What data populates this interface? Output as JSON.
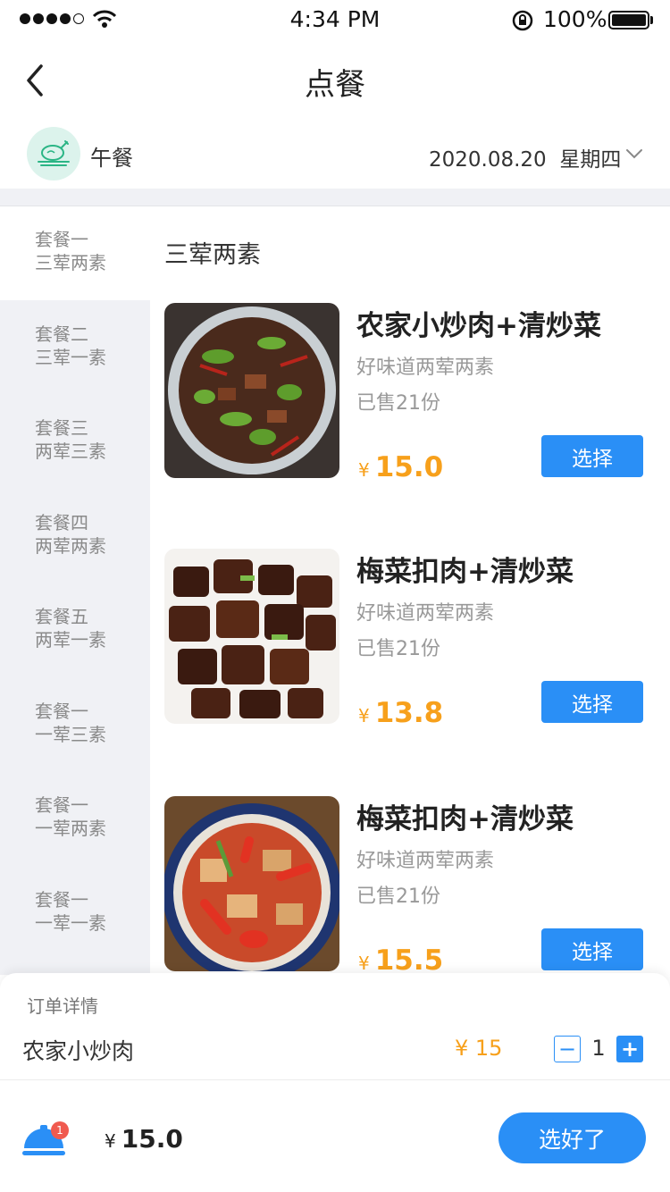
{
  "status_bar": {
    "time": "4:34 PM",
    "battery": "100%",
    "signal_bars": 4
  },
  "nav": {
    "title": "点餐"
  },
  "meal": {
    "label": "午餐",
    "date": "2020.08.20",
    "weekday": "星期四"
  },
  "sidebar": {
    "items": [
      {
        "line1": "套餐一",
        "line2": "三荤两素",
        "active": true
      },
      {
        "line1": "套餐二",
        "line2": "三荤一素"
      },
      {
        "line1": "套餐三",
        "line2": "两荤三素"
      },
      {
        "line1": "套餐四",
        "line2": "两荤两素"
      },
      {
        "line1": "套餐五",
        "line2": "两荤一素"
      },
      {
        "line1": "套餐一",
        "line2": "一荤三素"
      },
      {
        "line1": "套餐一",
        "line2": "一荤两素"
      },
      {
        "line1": "套餐一",
        "line2": "一荤一素"
      }
    ]
  },
  "content": {
    "section_title": "三荤两素",
    "currency": "¥",
    "dishes": [
      {
        "name": "农家小炒肉+清炒菜",
        "desc": "好味道两荤两素",
        "sold": "已售21份",
        "price": "15.0",
        "button": "选择"
      },
      {
        "name": "梅菜扣肉+清炒菜",
        "desc": "好味道两荤两素",
        "sold": "已售21份",
        "price": "13.8",
        "button": "选择"
      },
      {
        "name": "梅菜扣肉+清炒菜",
        "desc": "好味道两荤两素",
        "sold": "已售21份",
        "price": "15.5",
        "button": "选择"
      }
    ]
  },
  "order": {
    "header": "订单详情",
    "item": {
      "name": "农家小炒肉",
      "price": "¥ 15",
      "qty": "1"
    },
    "cart_badge": "1",
    "total_currency": "¥",
    "total": "15.0",
    "confirm": "选好了"
  },
  "colors": {
    "accent": "#2a8ff6",
    "price": "#f7a01b",
    "badge": "#f05a4f",
    "sidebar_bg": "#f0f1f5"
  }
}
